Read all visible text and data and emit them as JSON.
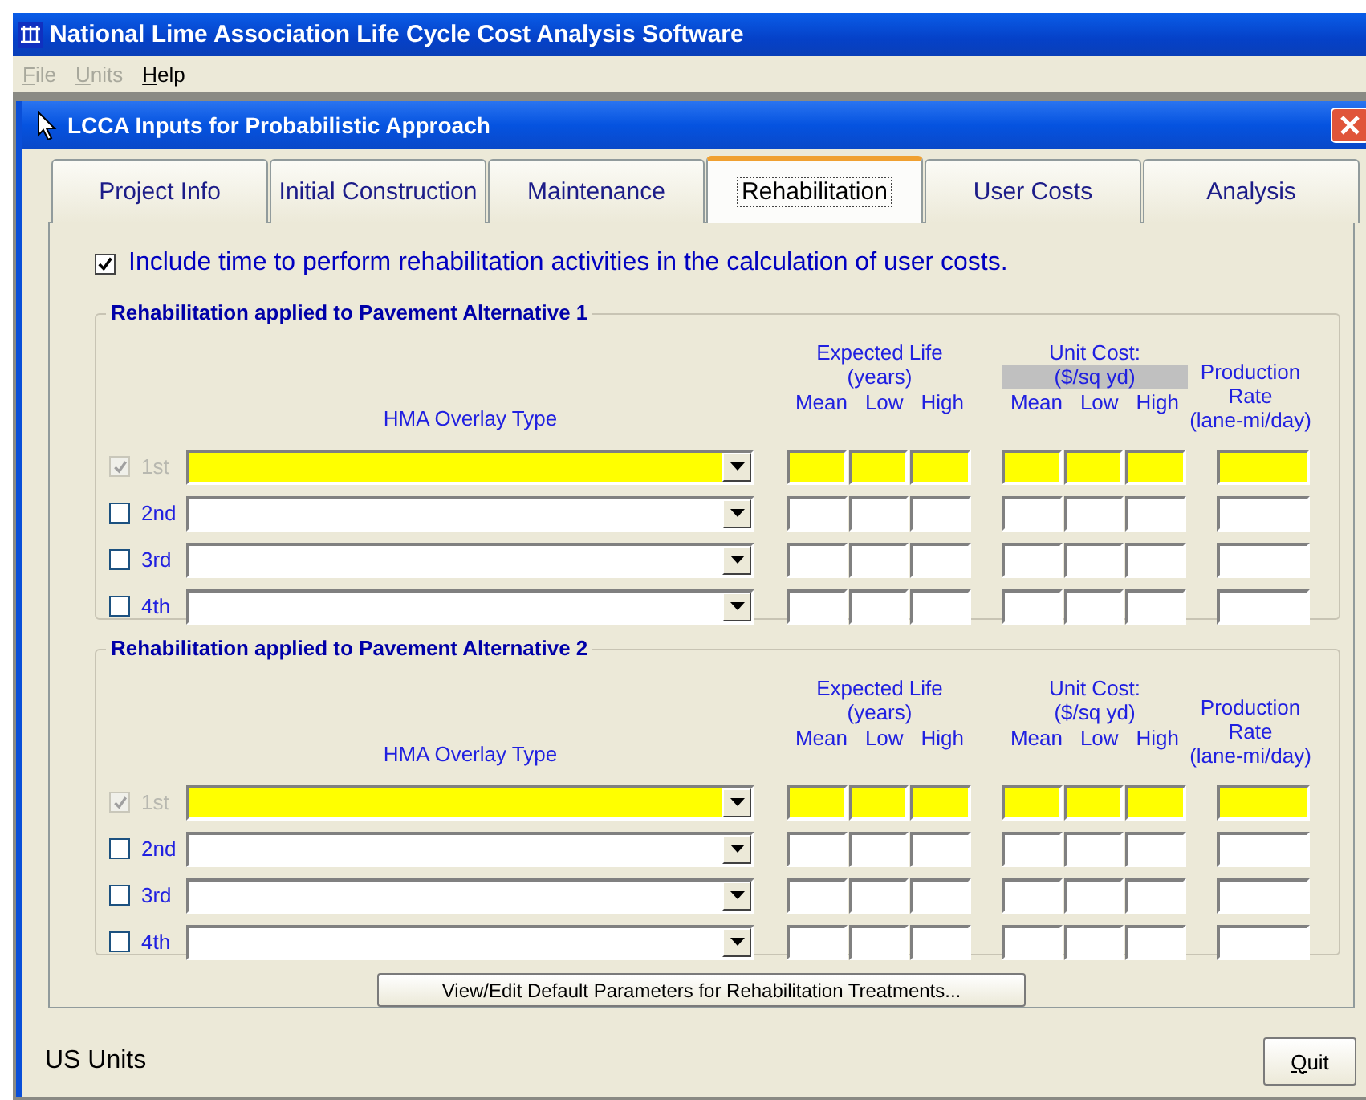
{
  "app_title": "National Lime Association Life Cycle Cost Analysis Software",
  "menu": [
    {
      "label": "File",
      "disabled": true
    },
    {
      "label": "Units",
      "disabled": true
    },
    {
      "label": "Help",
      "disabled": false
    }
  ],
  "dialog": {
    "title": "LCCA Inputs for Probabilistic Approach",
    "tabs": [
      {
        "label": "Project Info",
        "selected": false
      },
      {
        "label": "Initial Construction",
        "selected": false
      },
      {
        "label": "Maintenance",
        "selected": false
      },
      {
        "label": "Rehabilitation",
        "selected": true
      },
      {
        "label": "User Costs",
        "selected": false
      },
      {
        "label": "Analysis",
        "selected": false
      }
    ],
    "include_option": {
      "label": "Include time to perform rehabilitation activities in the calculation of user costs.",
      "checked": true
    },
    "groups": [
      {
        "title": "Rehabilitation applied to Pavement Alternative 1",
        "type_heading": "HMA Overlay Type",
        "life_heading": "Expected Life",
        "life_units": "(years)",
        "cost_heading": "Unit Cost:",
        "cost_units": "($/sq yd)",
        "cost_units_highlighted": true,
        "rate_heading": [
          "Production",
          "Rate",
          "(lane-mi/day)"
        ],
        "life_columns": [
          "Mean",
          "Low",
          "High"
        ],
        "cost_columns": [
          "Mean",
          "Low",
          "High"
        ],
        "rows": [
          {
            "label": "1st",
            "checked": true,
            "disabled": true,
            "required": true
          },
          {
            "label": "2nd",
            "checked": false,
            "disabled": false,
            "required": false
          },
          {
            "label": "3rd",
            "checked": false,
            "disabled": false,
            "required": false
          },
          {
            "label": "4th",
            "checked": false,
            "disabled": false,
            "required": false
          }
        ]
      },
      {
        "title": "Rehabilitation applied to Pavement Alternative 2",
        "type_heading": "HMA Overlay Type",
        "life_heading": "Expected Life",
        "life_units": "(years)",
        "cost_heading": "Unit Cost:",
        "cost_units": "($/sq yd)",
        "cost_units_highlighted": false,
        "rate_heading": [
          "Production",
          "Rate",
          "(lane-mi/day)"
        ],
        "life_columns": [
          "Mean",
          "Low",
          "High"
        ],
        "cost_columns": [
          "Mean",
          "Low",
          "High"
        ],
        "rows": [
          {
            "label": "1st",
            "checked": true,
            "disabled": true,
            "required": true
          },
          {
            "label": "2nd",
            "checked": false,
            "disabled": false,
            "required": false
          },
          {
            "label": "3rd",
            "checked": false,
            "disabled": false,
            "required": false
          },
          {
            "label": "4th",
            "checked": false,
            "disabled": false,
            "required": false
          }
        ]
      }
    ],
    "defaults_button": "View/Edit Default Parameters for Rehabilitation Treatments..."
  },
  "units_label": "US Units",
  "quit_button": "Quit"
}
